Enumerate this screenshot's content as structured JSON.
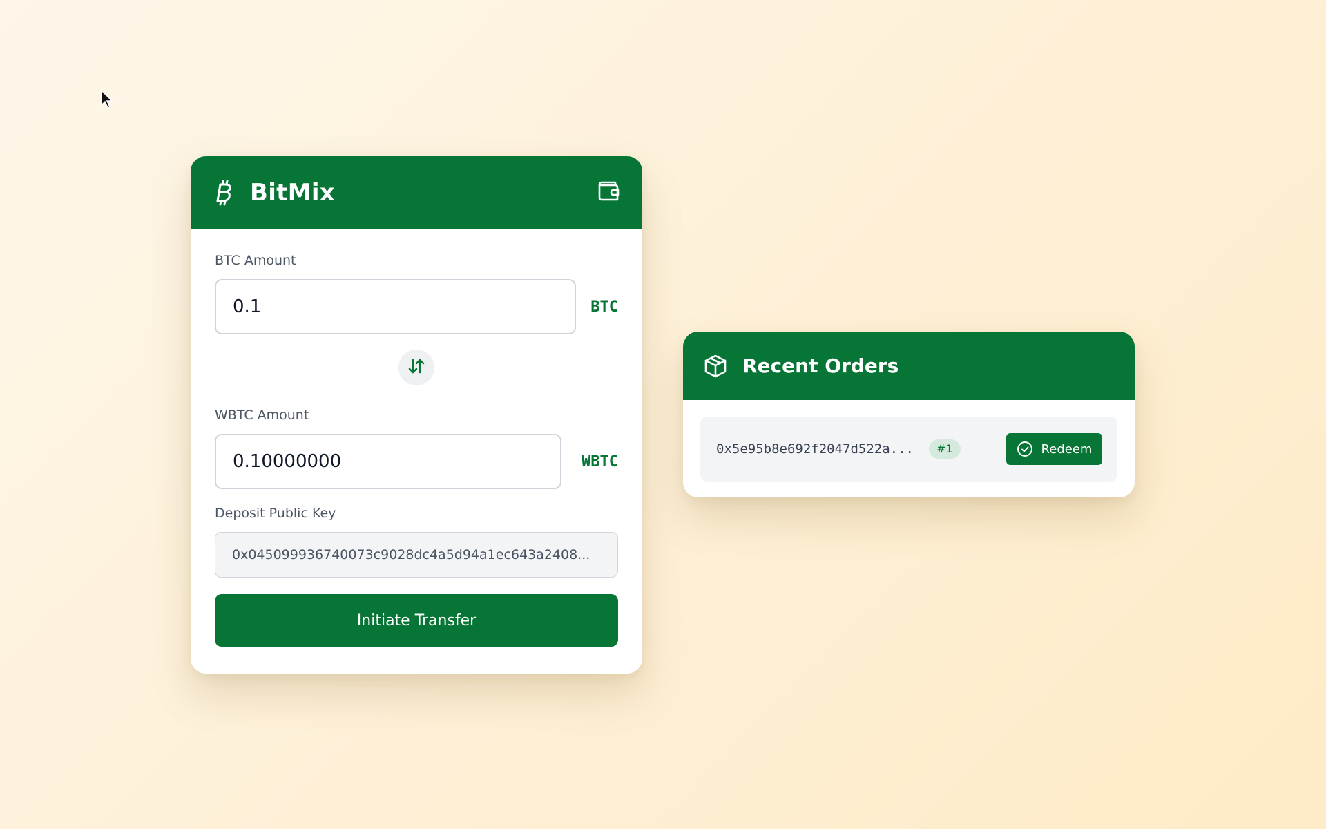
{
  "app": {
    "name": "BitMix",
    "brand_icon": "bitcoin-icon",
    "wallet_icon": "wallet-icon",
    "accent_color": "#077535"
  },
  "mixer": {
    "btc_label": "BTC Amount",
    "btc_value": "0.1",
    "btc_unit": "BTC",
    "swap_icon": "swap-vertical-icon",
    "wbtc_label": "WBTC Amount",
    "wbtc_value": "0.10000000",
    "wbtc_unit": "WBTC",
    "key_label": "Deposit Public Key",
    "key_value": "0x045099936740073c9028dc4a5d94a1ec643a2408...",
    "submit_label": "Initiate Transfer"
  },
  "orders": {
    "title": "Recent Orders",
    "icon": "package-icon",
    "items": [
      {
        "hash": "0x5e95b8e692f2047d522a...",
        "badge": "#1",
        "action_label": "Redeem",
        "action_icon": "check-circle-icon"
      }
    ]
  }
}
